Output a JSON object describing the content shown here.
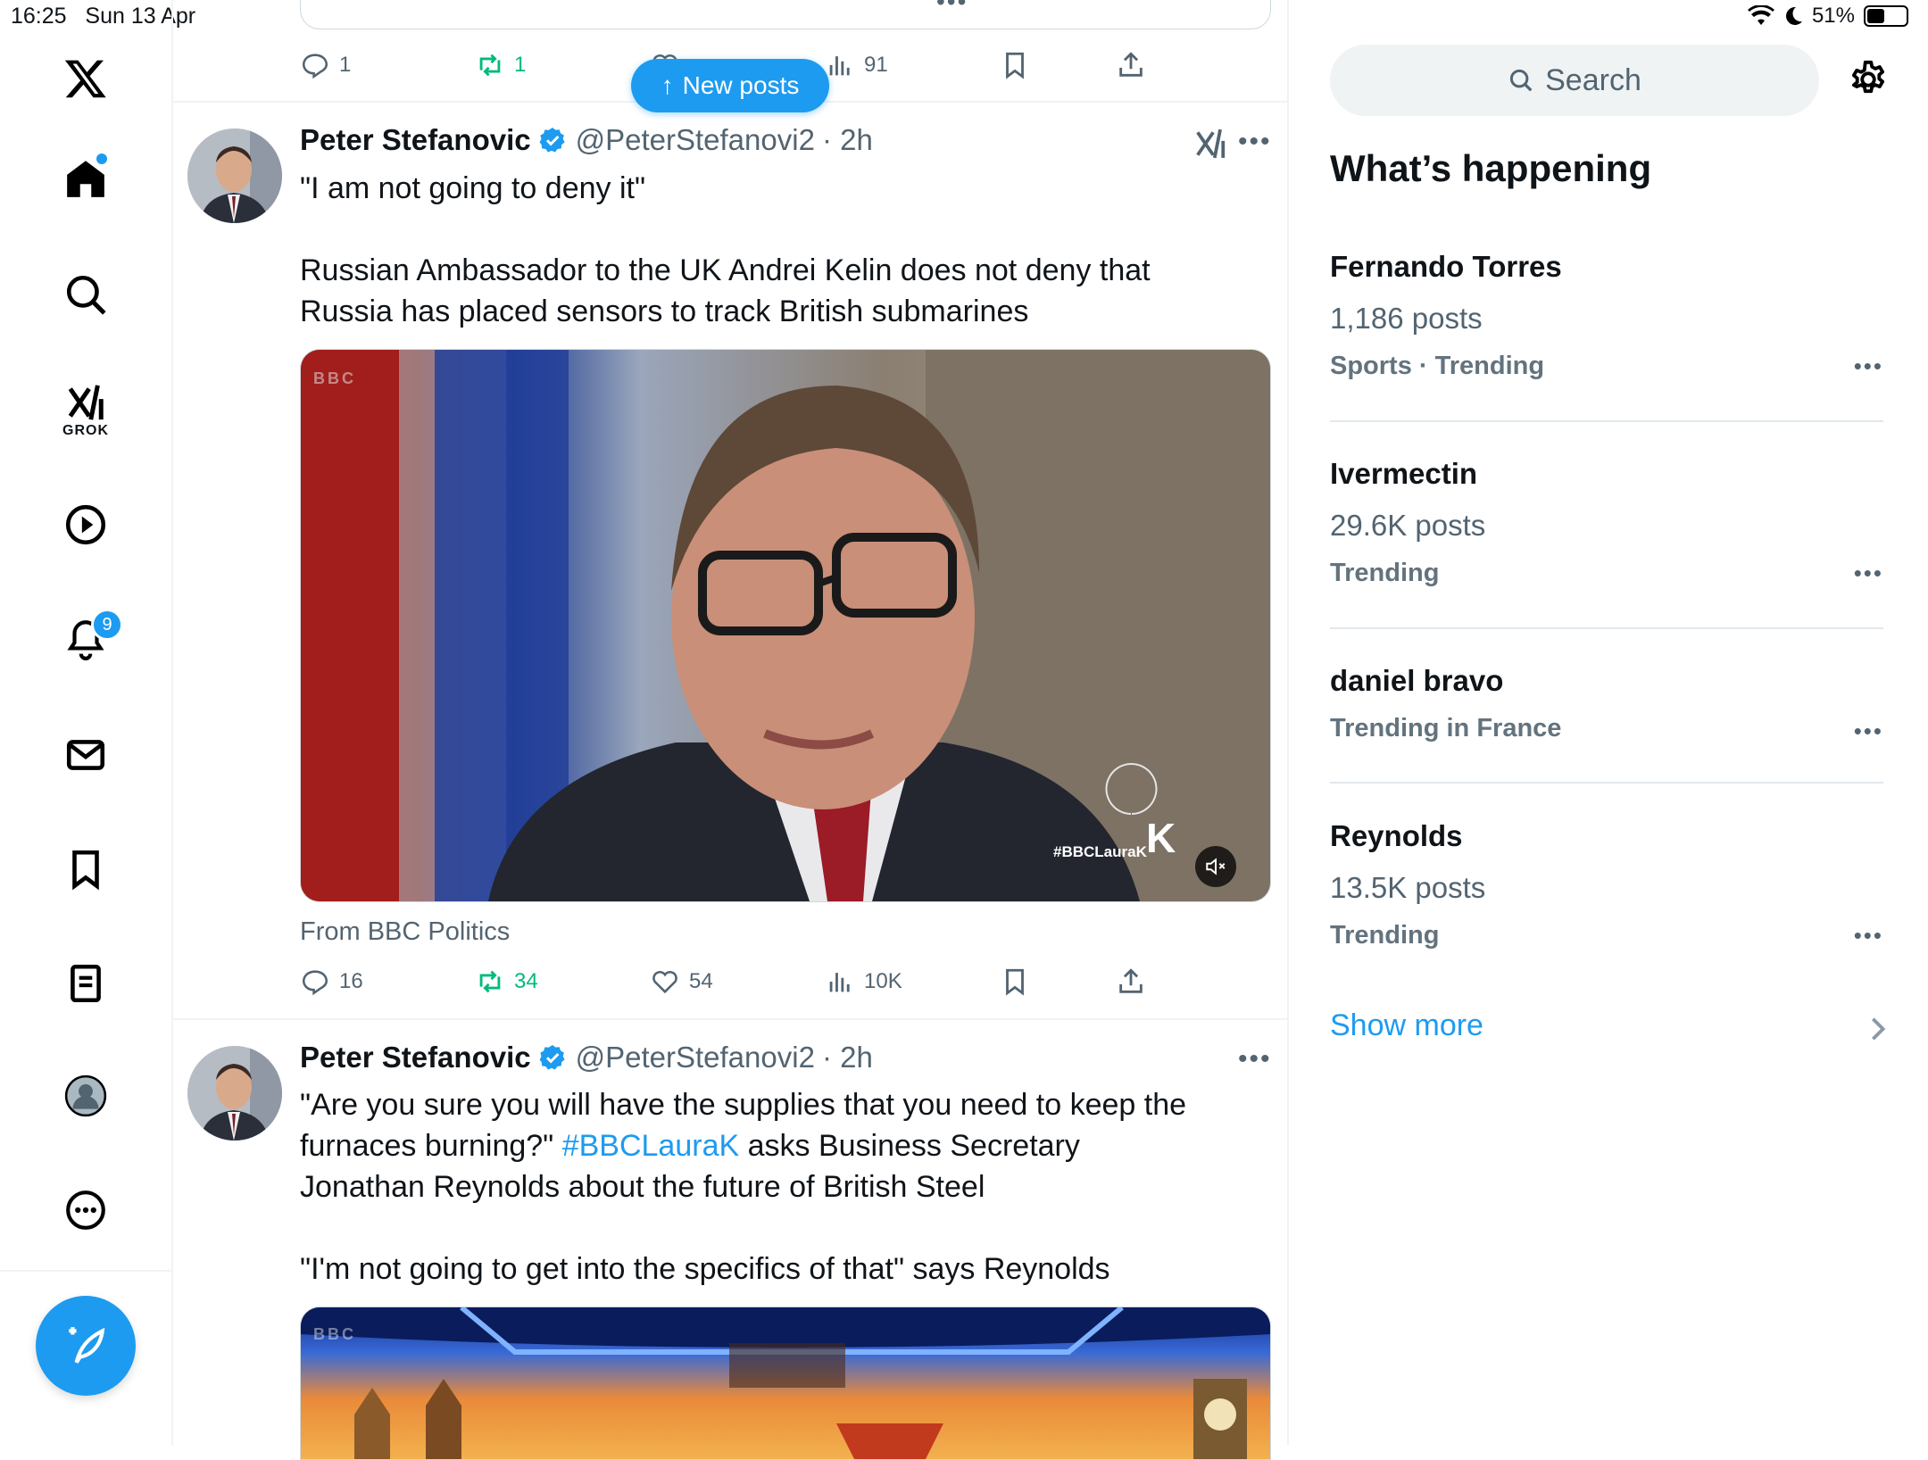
{
  "status_bar": {
    "time": "16:25",
    "date": "Sun 13 Apr",
    "battery": "51%",
    "battery_level": 0.51
  },
  "nav": {
    "logo": "x-logo-icon",
    "items": [
      {
        "name": "home-icon"
      },
      {
        "name": "search-icon"
      },
      {
        "name": "grok-icon",
        "label": "GROK"
      },
      {
        "name": "video-icon"
      },
      {
        "name": "notifications-icon",
        "badge": "9"
      },
      {
        "name": "messages-icon"
      },
      {
        "name": "bookmarks-icon"
      },
      {
        "name": "lists-icon"
      },
      {
        "name": "profile-icon"
      },
      {
        "name": "more-icon"
      }
    ],
    "compose": "compose-icon"
  },
  "feed": {
    "new_posts_label": "New posts",
    "prev_post_actions": {
      "replies": "1",
      "reposts": "1",
      "views": "91"
    },
    "posts": [
      {
        "name": "Peter Stefanovic",
        "handle": "@PeterStefanovi2",
        "time": "· 2h",
        "text_line1": "\"I am not going to deny it\"",
        "text_para2": "Russian Ambassador to the UK Andrei Kelin does not deny that Russia has placed sensors to track British submarines",
        "media_watermark": "BBC",
        "media_hashtag": "#BBCLauraK",
        "media_logo": "K",
        "source": "From BBC Politics",
        "replies": "16",
        "reposts": "34",
        "likes": "54",
        "views": "10K"
      },
      {
        "name": "Peter Stefanovic",
        "handle": "@PeterStefanovi2",
        "time": "· 2h",
        "text_part1": "\"Are you sure you will have the supplies that you need to keep the furnaces burning?\" ",
        "hashtag": "#BBCLauraK",
        "text_part2": " asks Business Secretary Jonathan Reynolds about the future of British Steel",
        "text_para2": "\"I'm not going to get into the specifics of that\" says Reynolds",
        "media_watermark": "BBC"
      }
    ]
  },
  "sidebar": {
    "search_placeholder": "Search",
    "heading": "What’s happening",
    "trends": [
      {
        "name": "Fernando Torres",
        "count": "1,186 posts",
        "category": "Sports · Trending"
      },
      {
        "name": "Ivermectin",
        "count": "29.6K posts",
        "category": "Trending"
      },
      {
        "name": "daniel bravo",
        "count": "",
        "category": "Trending in France"
      },
      {
        "name": "Reynolds",
        "count": "13.5K posts",
        "category": "Trending"
      }
    ],
    "show_more": "Show more"
  }
}
